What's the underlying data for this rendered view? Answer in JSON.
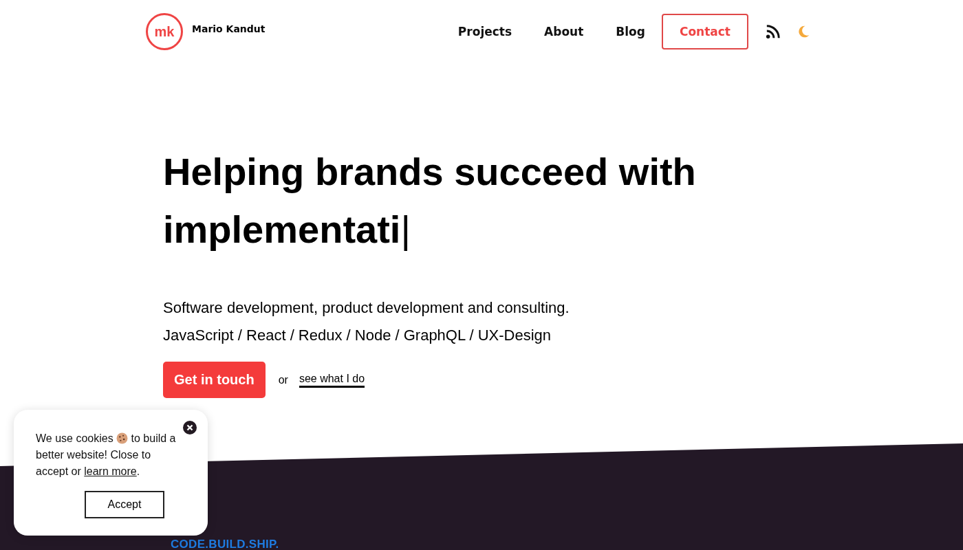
{
  "header": {
    "logo": "mk",
    "name": "Mario Kandut",
    "nav": [
      {
        "label": "Projects",
        "kind": "link"
      },
      {
        "label": "About",
        "kind": "link"
      },
      {
        "label": "Blog",
        "kind": "link"
      },
      {
        "label": "Contact",
        "kind": "button"
      }
    ]
  },
  "hero": {
    "headline": "Helping brands succeed with implementati",
    "cursor": "|",
    "lines": [
      "Software development, product development and consulting.",
      "JavaScript / React / Redux / Node / GraphQL / UX-Design"
    ],
    "cta": "Get in touch",
    "or": "or",
    "secondary_link": "see what I do"
  },
  "dark_section": {
    "tagline": "CODE.BUILD.SHIP."
  },
  "cookie_banner": {
    "text_before": "We use cookies",
    "text_after": "to build a better website! Close to accept or",
    "link": "learn more",
    "text_end": ".",
    "button": "Accept"
  }
}
